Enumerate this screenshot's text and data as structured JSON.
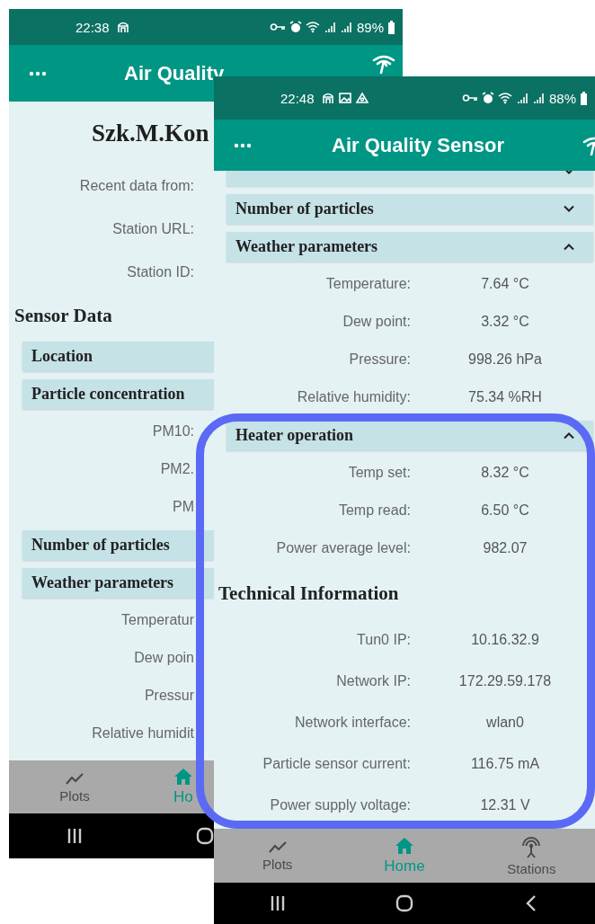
{
  "back_screen": {
    "status_bar": {
      "time": "22:38",
      "battery": "89%"
    },
    "app_bar": {
      "title": "Air Quality"
    },
    "station_name": "Szk.M.Kon",
    "info_rows": [
      {
        "label": "Recent data from:"
      },
      {
        "label": "Station URL:"
      },
      {
        "label": "Station ID:"
      }
    ],
    "section_title": "Sensor Data",
    "items": [
      {
        "kind": "header",
        "title": "Location"
      },
      {
        "kind": "header",
        "title": "Particle concentration"
      },
      {
        "kind": "row",
        "label": "PM10:"
      },
      {
        "kind": "row",
        "label": "PM2."
      },
      {
        "kind": "row",
        "label": "PM"
      },
      {
        "kind": "header",
        "title": "Number of particles"
      },
      {
        "kind": "header",
        "title": "Weather parameters"
      },
      {
        "kind": "row",
        "label": "Temperatur"
      },
      {
        "kind": "row",
        "label": "Dew poin"
      },
      {
        "kind": "row",
        "label": "Pressur"
      },
      {
        "kind": "row",
        "label": "Relative humidit"
      }
    ],
    "nav": [
      {
        "kind": "plots",
        "label": "Plots",
        "selected": false
      },
      {
        "kind": "home",
        "label": "Ho",
        "selected": true
      }
    ]
  },
  "front_screen": {
    "status_bar": {
      "time": "22:48",
      "battery": "88%"
    },
    "app_bar": {
      "title": "Air Quality Sensor"
    },
    "items": [
      {
        "kind": "header",
        "expanded": false
      },
      {
        "kind": "header",
        "title": "Number of particles",
        "expanded": false
      },
      {
        "kind": "header",
        "title": "Weather parameters",
        "expanded": true
      },
      {
        "kind": "row",
        "label": "Temperature:",
        "value": "7.64 °C"
      },
      {
        "kind": "row",
        "label": "Dew point:",
        "value": "3.32 °C"
      },
      {
        "kind": "row",
        "label": "Pressure:",
        "value": "998.26 hPa"
      },
      {
        "kind": "row",
        "label": "Relative humidity:",
        "value": "75.34 %RH"
      },
      {
        "kind": "header",
        "title": "Heater operation",
        "expanded": true
      },
      {
        "kind": "row",
        "label": "Temp set:",
        "value": "8.32 °C"
      },
      {
        "kind": "row",
        "label": "Temp read:",
        "value": "6.50 °C"
      },
      {
        "kind": "row",
        "label": "Power average level:",
        "value": "982.07"
      },
      {
        "kind": "section",
        "title": "Technical Information"
      },
      {
        "kind": "tech",
        "label": "Tun0 IP:",
        "value": "10.16.32.9"
      },
      {
        "kind": "tech",
        "label": "Network IP:",
        "value": "172.29.59.178"
      },
      {
        "kind": "tech",
        "label": "Network interface:",
        "value": "wlan0"
      },
      {
        "kind": "tech",
        "label": "Particle sensor current:",
        "value": "116.75 mA"
      },
      {
        "kind": "tech",
        "label": "Power supply voltage:",
        "value": "12.31 V"
      }
    ],
    "nav": [
      {
        "kind": "plots",
        "label": "Plots",
        "selected": false
      },
      {
        "kind": "home",
        "label": "Home",
        "selected": true
      },
      {
        "kind": "stations",
        "label": "Stations",
        "selected": false
      }
    ]
  }
}
